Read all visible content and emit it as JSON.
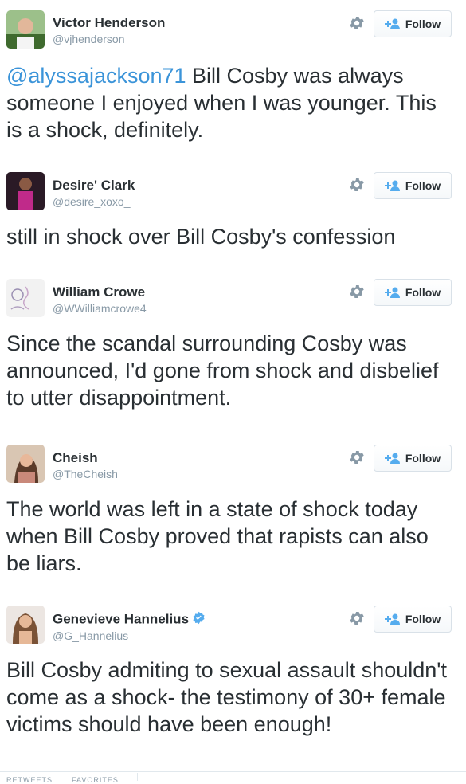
{
  "tweets": [
    {
      "name": "Victor Henderson",
      "handle": "@vjhenderson",
      "mention": "@alyssajackson71",
      "text": " Bill Cosby was always someone I enjoyed when I was younger. This is a shock, definitely.",
      "follow_label": "Follow"
    },
    {
      "name": "Desire' Clark",
      "handle": "@desire_xoxo_",
      "text": "still in shock over Bill Cosby's confession",
      "follow_label": "Follow"
    },
    {
      "name": "William Crowe",
      "handle": "@WWilliamcrowe4",
      "text": "Since the scandal surrounding Cosby was announced, I'd gone from shock and disbelief to utter disappointment.",
      "follow_label": "Follow"
    },
    {
      "name": "Cheish",
      "handle": "@TheCheish",
      "text": "The world was left in a state of shock today when Bill Cosby proved that rapists can also be liars.",
      "follow_label": "Follow"
    },
    {
      "name": "Genevieve Hannelius",
      "handle": "@G_Hannelius",
      "verified": true,
      "text": "Bill Cosby admiting to sexual assault shouldn't come as a shock- the testimony of 30+ female victims should have been enough!",
      "follow_label": "Follow"
    }
  ],
  "footer": {
    "left_label": "RETWEETS",
    "right_label": "FAVORITES"
  },
  "colors": {
    "link": "#3b94d9",
    "text": "#292f33",
    "muted": "#8899a6",
    "verified": "#55acee"
  }
}
